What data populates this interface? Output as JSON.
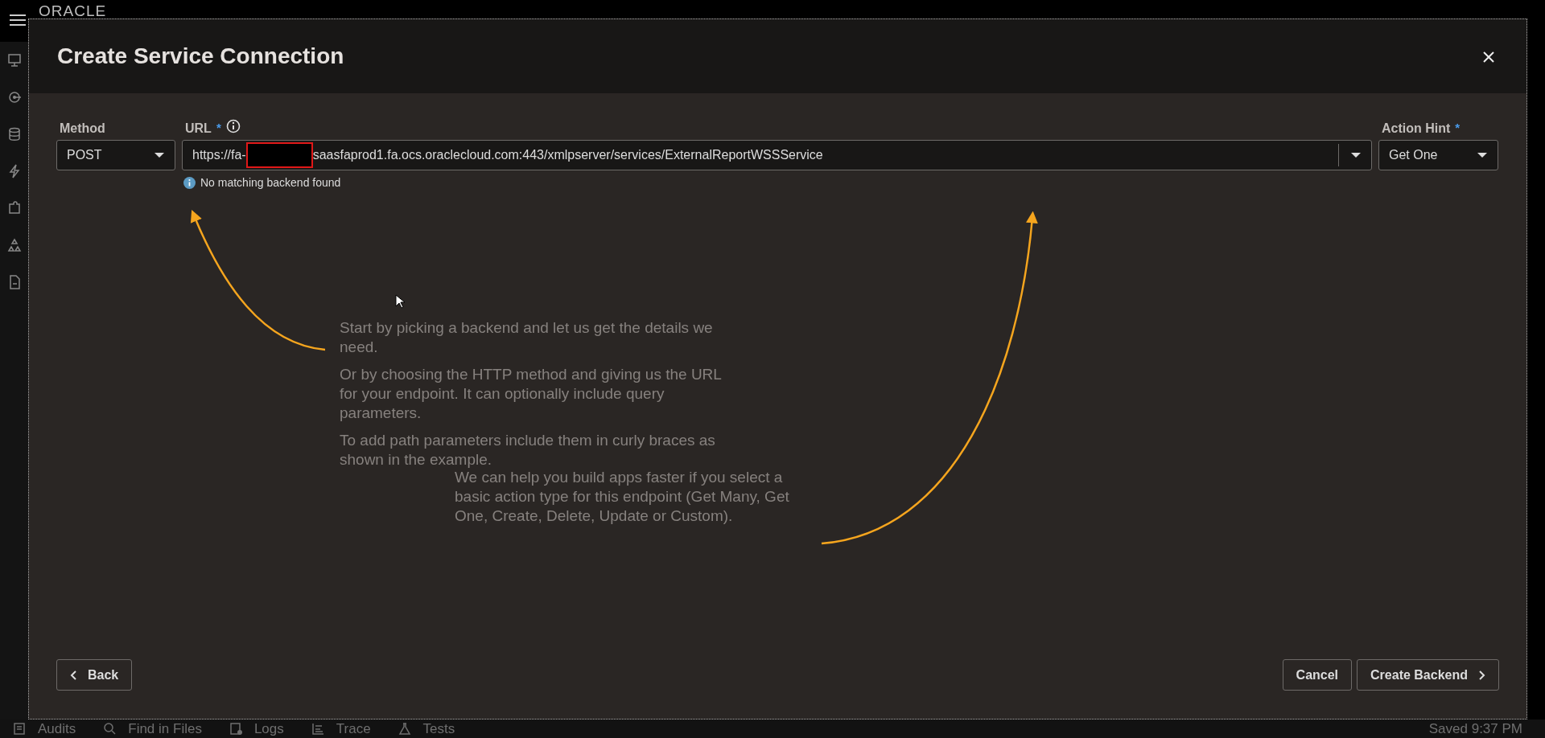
{
  "app_bar": {
    "logo": "ORACLE"
  },
  "bottom_bar": {
    "items": [
      {
        "label": "Audits",
        "kind": "audits"
      },
      {
        "label": "Find in Files",
        "kind": "search"
      },
      {
        "label": "Logs",
        "kind": "logs"
      },
      {
        "label": "Trace",
        "kind": "trace"
      },
      {
        "label": "Tests",
        "kind": "tests"
      }
    ],
    "status": "Saved 9:37 PM"
  },
  "dialog": {
    "title": "Create Service Connection",
    "fields": {
      "method": {
        "label": "Method",
        "value": "POST"
      },
      "url": {
        "label": "URL",
        "required_mark": "*",
        "value_prefix": "https://fa-",
        "redacted": true,
        "value_suffix": "saasfaprod1.fa.ocs.oraclecloud.com:443/xmlpserver/services/ExternalReportWSSService",
        "message": "No matching backend found"
      },
      "action_hint": {
        "label": "Action Hint",
        "required_mark": "*",
        "value": "Get One"
      }
    },
    "help": [
      {
        "paragraphs": [
          "Start by picking a backend and let us get the details we need.",
          "Or by choosing the HTTP method and giving us the URL for your endpoint. It can optionally include query parameters.",
          "To add path parameters include them in curly braces as shown in the example."
        ]
      },
      {
        "paragraphs": [
          "We can help you build apps faster if you select a basic action type for this endpoint (Get Many, Get One, Create, Delete, Update or Custom)."
        ]
      }
    ],
    "buttons": {
      "back": "Back",
      "cancel": "Cancel",
      "create": "Create Backend"
    }
  }
}
